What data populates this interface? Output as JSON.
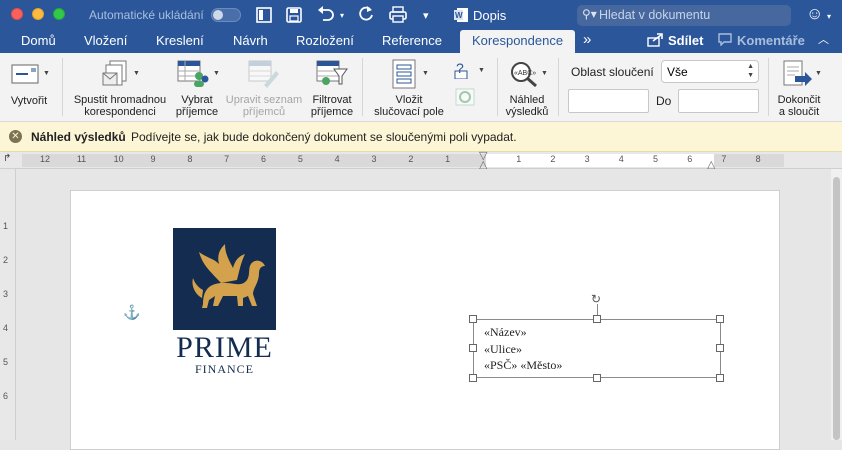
{
  "window": {
    "autosave_label": "Automatické ukládání",
    "doc_title": "Dopis",
    "search_placeholder": "Hledat v dokumentu",
    "colors": {
      "titlebar": "#2b579a",
      "accent": "#2b579a",
      "info_bg": "#fcf5d6"
    }
  },
  "tabs": [
    {
      "label": "Domů"
    },
    {
      "label": "Vložení"
    },
    {
      "label": "Kreslení"
    },
    {
      "label": "Návrh"
    },
    {
      "label": "Rozložení"
    },
    {
      "label": "Reference"
    },
    {
      "label": "Korespondence",
      "active": true
    }
  ],
  "tabs_more": "»",
  "share_label": "Sdílet",
  "comments_label": "Komentáře",
  "ribbon": {
    "create": "Vytvořit",
    "start_merge": [
      "Spustit hromadnou",
      "korespondenci"
    ],
    "select_recipients": [
      "Vybrat",
      "příjemce"
    ],
    "edit_list": [
      "Upravit seznam",
      "příjemců"
    ],
    "filter": [
      "Filtrovat",
      "příjemce"
    ],
    "insert_field": [
      "Vložit",
      "slučovací pole"
    ],
    "preview": [
      "Náhled",
      "výsledků"
    ],
    "merge_range_label": "Oblast sloučení",
    "merge_range_value": "Vše",
    "to_label": "Do",
    "finish": [
      "Dokončit",
      "a sloučit"
    ]
  },
  "info_bar": {
    "title": "Náhled výsledků",
    "message": "Podívejte se, jak bude dokončený dokument se sloučenými poli vypadat."
  },
  "ruler": {
    "numbers": [
      "12",
      "11",
      "10",
      "9",
      "8",
      "7",
      "6",
      "5",
      "4",
      "3",
      "2",
      "1",
      "1",
      "2",
      "3",
      "4",
      "5",
      "6",
      "7",
      "8"
    ],
    "v_numbers": [
      "1",
      "2",
      "3",
      "4",
      "5",
      "6"
    ]
  },
  "document": {
    "logo_line1": "PRIME",
    "logo_line2": "FINANCE",
    "merge_fields": [
      "«Název»",
      "«Ulice»",
      "«PSČ» «Město»"
    ]
  }
}
